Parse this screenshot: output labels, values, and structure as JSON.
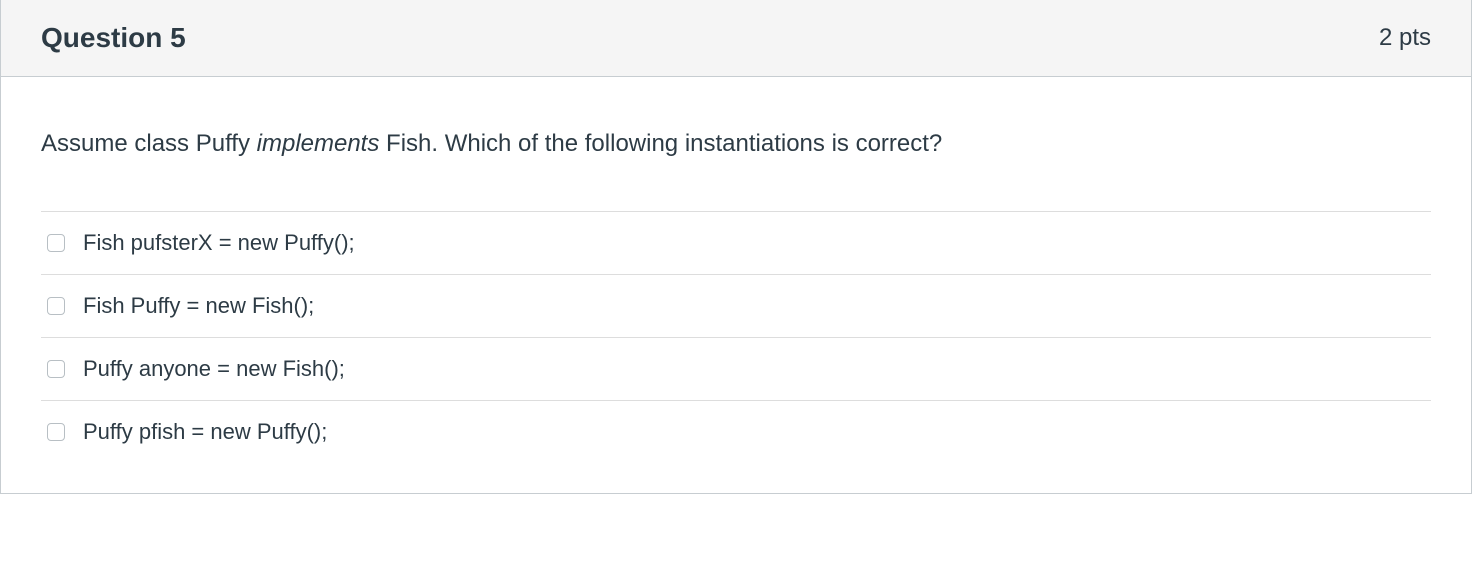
{
  "header": {
    "title": "Question 5",
    "points": "2 pts"
  },
  "question": {
    "prefix": "Assume class Puffy ",
    "italic": "implements",
    "suffix": " Fish. Which of the following instantiations is correct?"
  },
  "answers": [
    {
      "label": "Fish pufsterX = new Puffy();"
    },
    {
      "label": "Fish Puffy = new Fish();"
    },
    {
      "label": "Puffy anyone = new Fish();"
    },
    {
      "label": "Puffy pfish = new Puffy();"
    }
  ]
}
